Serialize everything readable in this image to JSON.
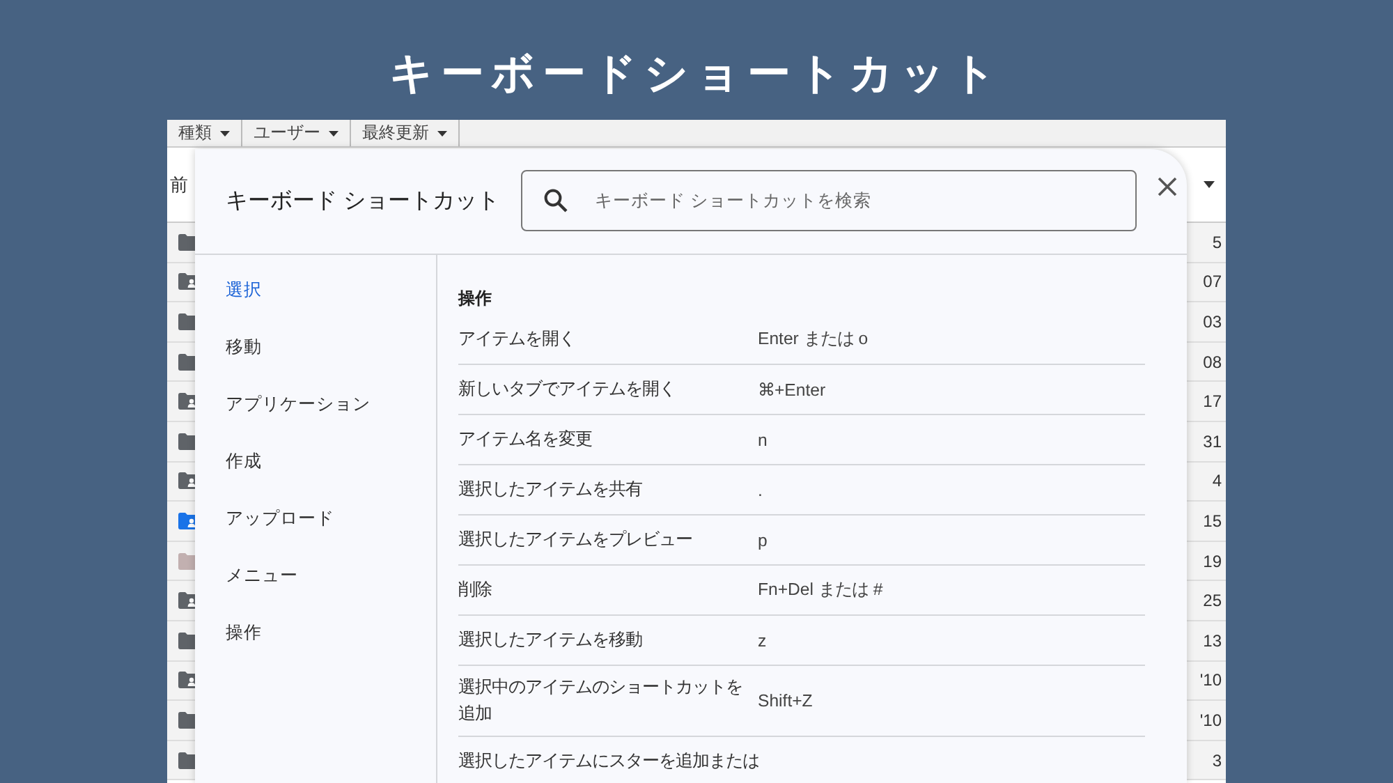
{
  "slide_title": "キーボードショートカット",
  "file_list": {
    "filters": [
      {
        "label": "種類"
      },
      {
        "label": "ユーザー"
      },
      {
        "label": "最終更新"
      }
    ],
    "column_1": "前",
    "rows": [
      {
        "kind": "folder",
        "color": "#5f6368",
        "modified": "5"
      },
      {
        "kind": "shared",
        "color": "#5f6368",
        "modified": "07"
      },
      {
        "kind": "folder",
        "color": "#5f6368",
        "modified": "03"
      },
      {
        "kind": "folder",
        "color": "#5f6368",
        "modified": "08"
      },
      {
        "kind": "shared",
        "color": "#5f6368",
        "modified": "17"
      },
      {
        "kind": "folder",
        "color": "#5f6368",
        "modified": "31"
      },
      {
        "kind": "shared",
        "color": "#5f6368",
        "modified": "4"
      },
      {
        "kind": "shared",
        "color": "#1a73e8",
        "modified": "15"
      },
      {
        "kind": "folder",
        "color": "#c2b0b0",
        "modified": "19"
      },
      {
        "kind": "shared",
        "color": "#5f6368",
        "modified": "25"
      },
      {
        "kind": "folder",
        "color": "#5f6368",
        "modified": "13"
      },
      {
        "kind": "shared",
        "color": "#5f6368",
        "modified": "'10"
      },
      {
        "kind": "folder",
        "color": "#5f6368",
        "modified": "'10"
      },
      {
        "kind": "folder",
        "color": "#5f6368",
        "modified": "3"
      }
    ]
  },
  "dialog": {
    "title": "キーボード ショートカット",
    "search": {
      "placeholder": "キーボード ショートカットを検索"
    },
    "nav": [
      {
        "label": "選択",
        "selected": true
      },
      {
        "label": "移動",
        "selected": false
      },
      {
        "label": "アプリケーション",
        "selected": false
      },
      {
        "label": "作成",
        "selected": false
      },
      {
        "label": "アップロード",
        "selected": false
      },
      {
        "label": "メニュー",
        "selected": false
      },
      {
        "label": "操作",
        "selected": false
      }
    ],
    "section_title": "操作",
    "shortcuts": [
      {
        "action": "アイテムを開く",
        "keys": "Enter または o"
      },
      {
        "action": "新しいタブでアイテムを開く",
        "keys": "⌘+Enter"
      },
      {
        "action": "アイテム名を変更",
        "keys": "n"
      },
      {
        "action": "選択したアイテムを共有",
        "keys": "."
      },
      {
        "action": "選択したアイテムをプレビュー",
        "keys": "p"
      },
      {
        "action": "削除",
        "keys": "Fn+Del または #"
      },
      {
        "action": "選択したアイテムを移動",
        "keys": "z"
      },
      {
        "action": "選択中のアイテムのショートカットを追加",
        "keys": "Shift+Z"
      },
      {
        "action": "選択したアイテムにスターを追加または"
      }
    ]
  }
}
